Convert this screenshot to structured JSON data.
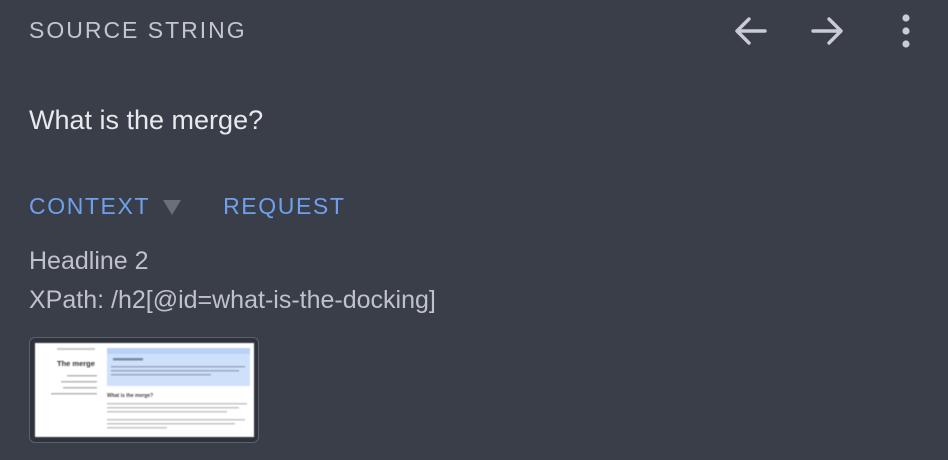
{
  "header": {
    "title": "SOURCE STRING"
  },
  "source": {
    "text": "What is the merge?"
  },
  "tabs": [
    {
      "label": "CONTEXT",
      "has_dropdown": true
    },
    {
      "label": "REQUEST"
    }
  ],
  "context": {
    "element_type": "Headline 2",
    "xpath": "XPath: /h2[@id=what-is-the-docking]"
  },
  "screenshot_thumbnail": {
    "page_heading": "The merge",
    "section_heading": "What is the merge?"
  },
  "colors": {
    "background": "#393e48",
    "accent": "#6fa0ee",
    "text_primary": "#e8e9ec",
    "text_secondary": "#bfc2c8",
    "icon": "#c9ccd2"
  },
  "icons": [
    "arrow-left-icon",
    "arrow-right-icon",
    "more-vertical-icon",
    "chevron-down-icon"
  ]
}
